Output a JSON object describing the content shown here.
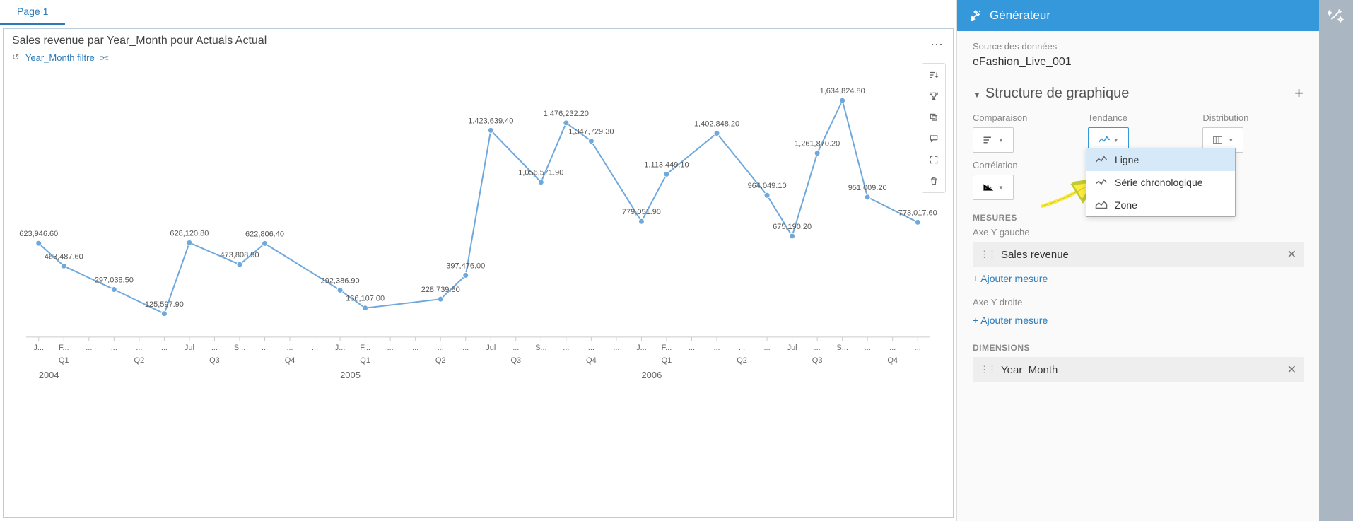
{
  "tabs": {
    "page1": "Page 1"
  },
  "chart": {
    "title": "Sales revenue par Year_Month pour Actuals Actual",
    "filter": "Year_Month filtre"
  },
  "toolbar_icons": {
    "more": "⋯",
    "sort": "sort-icon",
    "rank": "trophy-icon",
    "copy": "copy-icon",
    "comment": "comment-icon",
    "fullscreen": "fullscreen-icon",
    "delete": "delete-icon"
  },
  "panel": {
    "header": "Générateur",
    "source_label": "Source des données",
    "source_value": "eFashion_Live_001",
    "structure_title": "Structure de graphique",
    "struct": {
      "comparison": "Comparaison",
      "trend": "Tendance",
      "distribution": "Distribution",
      "correlation": "Corrélation"
    },
    "dropdown": {
      "line": "Ligne",
      "timeseries": "Série chronologique",
      "area": "Zone"
    },
    "measures": "MESURES",
    "axis_left": "Axe Y gauche",
    "axis_right": "Axe Y droite",
    "measure_chip": "Sales revenue",
    "add_measure": "+ Ajouter mesure",
    "dimensions": "DIMENSIONS",
    "dimension_chip": "Year_Month"
  },
  "chart_data": {
    "type": "line",
    "title": "Sales revenue par Year_Month pour Actuals Actual",
    "ylabel": "Sales revenue",
    "xlabel": "Year_Month",
    "years": [
      "2004",
      "2005",
      "2006"
    ],
    "quarters": [
      "Q1",
      "Q2",
      "Q3",
      "Q4",
      "Q1",
      "Q2",
      "Q3",
      "Q4",
      "Q1",
      "Q2",
      "Q3",
      "Q4"
    ],
    "month_labels": [
      "J...",
      "F...",
      "...",
      "...",
      "...",
      "...",
      "Jul",
      "...",
      "S...",
      "...",
      "...",
      "...",
      "J...",
      "F...",
      "...",
      "...",
      "...",
      "...",
      "Jul",
      "...",
      "S...",
      "...",
      "...",
      "...",
      "J...",
      "F...",
      "...",
      "...",
      "...",
      "...",
      "Jul",
      "...",
      "S...",
      "...",
      "...",
      "..."
    ],
    "values": [
      623946.6,
      463487.6,
      null,
      297038.5,
      null,
      125597.9,
      628120.8,
      null,
      473808.9,
      622806.4,
      null,
      null,
      292386.9,
      166107.0,
      null,
      null,
      228739.8,
      397476.0,
      1423639.4,
      null,
      1056571.9,
      1476232.2,
      1347729.3,
      null,
      779051.9,
      1113449.1,
      null,
      1402848.2,
      null,
      964049.1,
      675190.2,
      1261870.2,
      1634824.8,
      951009.2,
      null,
      773017.6
    ],
    "ylim": [
      0,
      1800000
    ]
  }
}
